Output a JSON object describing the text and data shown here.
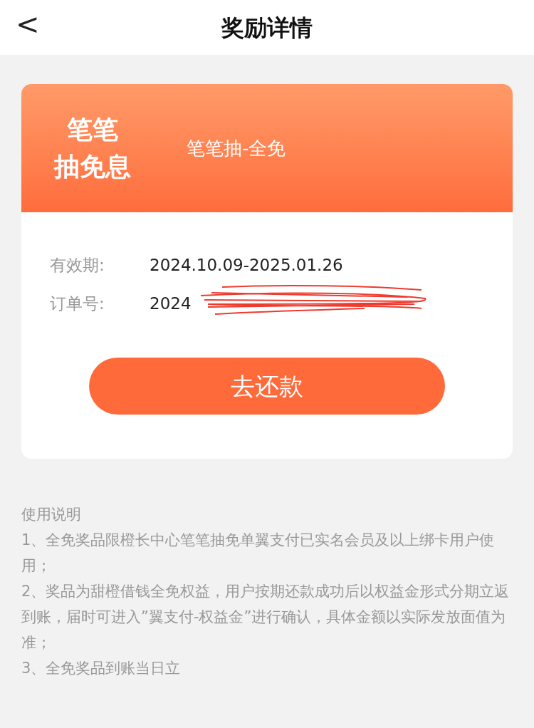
{
  "header": {
    "back": "<",
    "title": "奖励详情"
  },
  "reward": {
    "badge_lines": [
      "笔笔",
      "抽免息"
    ],
    "name": "笔笔抽-全免"
  },
  "details": [
    {
      "kind": "text",
      "label": "有效期:",
      "value": "2024.10.09-2025.01.26"
    },
    {
      "kind": "redacted",
      "label": "订单号:",
      "value": "2024"
    }
  ],
  "action": "去还款",
  "instructions": {
    "title": "使用说明",
    "lines": [
      "1、全免奖品限橙长中心笔笔抽免单翼支付已实名会员及以上绑卡用户使用；",
      "2、奖品为甜橙借钱全免权益，用户按期还款成功后以权益金形式分期立返到账，届时可进入”翼支付-权益金”进行确认，具体金额以实际发放面值为准；",
      "3、全免奖品到账当日立"
    ]
  }
}
